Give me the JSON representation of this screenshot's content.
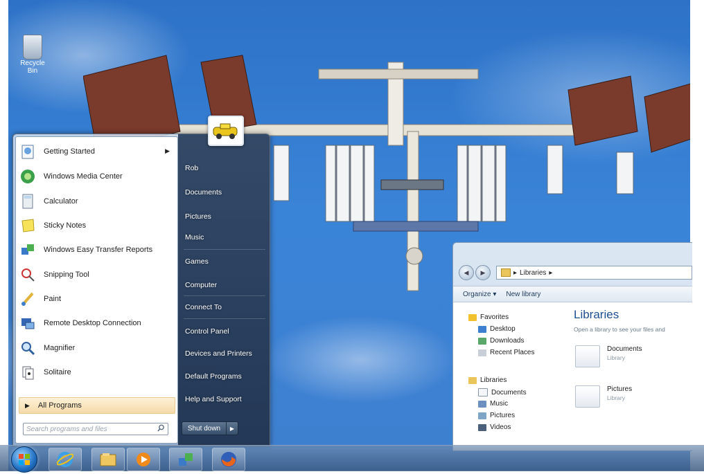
{
  "desktop": {
    "recycle_bin_label": "Recycle Bin"
  },
  "start_menu": {
    "programs": [
      {
        "label": "Getting Started",
        "icon": "getting-started-icon",
        "has_submenu": true
      },
      {
        "label": "Windows Media Center",
        "icon": "media-center-icon",
        "has_submenu": false
      },
      {
        "label": "Calculator",
        "icon": "calculator-icon",
        "has_submenu": false
      },
      {
        "label": "Sticky Notes",
        "icon": "sticky-notes-icon",
        "has_submenu": false
      },
      {
        "label": "Windows Easy Transfer Reports",
        "icon": "easy-transfer-icon",
        "has_submenu": false
      },
      {
        "label": "Snipping Tool",
        "icon": "snipping-tool-icon",
        "has_submenu": false
      },
      {
        "label": "Paint",
        "icon": "paint-icon",
        "has_submenu": false
      },
      {
        "label": "Remote Desktop Connection",
        "icon": "remote-desktop-icon",
        "has_submenu": false
      },
      {
        "label": "Magnifier",
        "icon": "magnifier-icon",
        "has_submenu": false
      },
      {
        "label": "Solitaire",
        "icon": "solitaire-icon",
        "has_submenu": false
      }
    ],
    "all_programs_label": "All Programs",
    "search_placeholder": "Search programs and files",
    "places": [
      "Rob",
      "Documents",
      "Pictures",
      "Music",
      "Games",
      "Computer",
      "Connect To",
      "Control Panel",
      "Devices and Printers",
      "Default Programs",
      "Help and Support"
    ],
    "shutdown_label": "Shut down"
  },
  "explorer": {
    "address_path": "Libraries",
    "toolbar": {
      "organize": "Organize ▾",
      "new_library": "New library"
    },
    "favorites_header": "Favorites",
    "favorites": [
      "Desktop",
      "Downloads",
      "Recent Places"
    ],
    "libraries_header": "Libraries",
    "libraries_nav": [
      "Documents",
      "Music",
      "Pictures",
      "Videos"
    ],
    "title": "Libraries",
    "subtitle": "Open a library to see your files and",
    "entries": [
      {
        "name": "Documents",
        "kind": "Library"
      },
      {
        "name": "Pictures",
        "kind": "Library"
      }
    ]
  },
  "taskbar": {
    "pinned": [
      "internet-explorer-icon",
      "libraries-folder-icon",
      "media-player-icon",
      "easy-transfer-icon",
      "firefox-icon"
    ]
  },
  "colors": {
    "sky": "#3a84d8",
    "menu_right_pane": "#283e5c",
    "library_title": "#1e4f8f",
    "all_programs_highlight": "#f6dba8"
  }
}
